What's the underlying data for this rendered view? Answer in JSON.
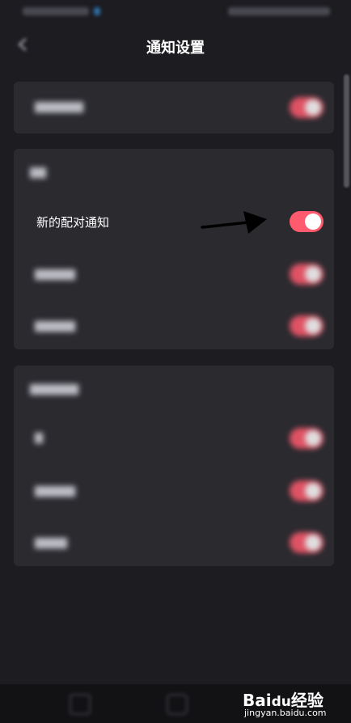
{
  "header": {
    "title": "通知设置"
  },
  "card_2": {
    "highlighted_row_label": "新的配对通知"
  },
  "toggles": {
    "all_on": true
  },
  "watermark": {
    "brand": "Bai",
    "brand_suffix": "经验",
    "paw": "du",
    "url": "jingyan.baidu.com"
  },
  "colors": {
    "background": "#1c1c21",
    "card": "#2a2a2f",
    "toggle_on": "#ff5a6e"
  }
}
